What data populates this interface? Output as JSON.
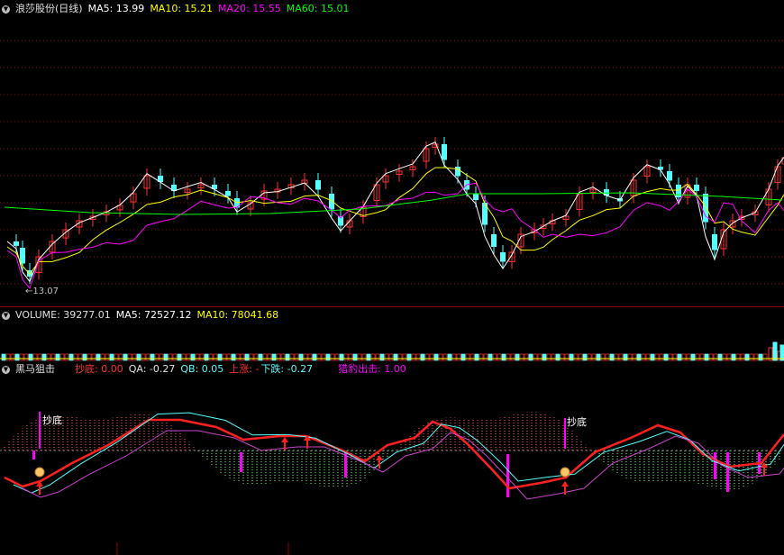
{
  "price_panel": {
    "stock_title": "浪莎股份(日线)",
    "ma5": "MA5: 13.99",
    "ma10": "MA10: 15.21",
    "ma20": "MA20: 15.55",
    "ma60": "MA60: 15.01",
    "low_marker": "13.07",
    "colors": {
      "ma5": "#ffffff",
      "ma10": "#ffff00",
      "ma20": "#ff00ff",
      "ma60": "#00ff00",
      "up": "#ff3232",
      "down": "#54ffff"
    }
  },
  "volume_panel": {
    "title": "VOLUME: 39277.01",
    "ma5": "MA5: 72527.12",
    "ma10": "MA10: 78041.68"
  },
  "indicator_panel": {
    "name": "黑马狙击",
    "chaodi": "抄底: 0.00",
    "qa": "QA: -0.27",
    "qb": "QB: 0.05",
    "shangzhang": "上涨: -",
    "xiadie": "下跌: -0.27",
    "lieyue": "猎豹出击: 1.00",
    "signal_label": "抄底"
  },
  "icons": {
    "dropdown": "circle-down-icon",
    "pointer": "hand-pointer-icon",
    "arrow": "up-arrow-icon"
  }
}
